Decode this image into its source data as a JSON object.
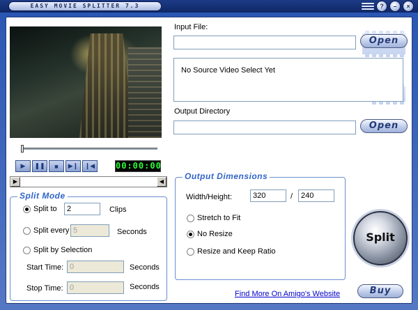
{
  "window": {
    "title": "EASY MOVIE SPLITTER 7.3",
    "minimize": "–",
    "close": "×",
    "help": "?"
  },
  "player": {
    "timecode": "00:00:00",
    "buttons": [
      "play",
      "pause",
      "stop",
      "next-frame",
      "previous"
    ]
  },
  "input": {
    "label": "Input File:",
    "value": "",
    "open_label": "Open",
    "info_text": "No Source Video Select Yet"
  },
  "output": {
    "label": "Output Directory",
    "value": "",
    "open_label": "Open"
  },
  "split_mode": {
    "title": "Split Mode",
    "split_to_label": "Split to",
    "split_to_value": "2",
    "clips_label": "Clips",
    "split_every_label": "Split every",
    "split_every_value": "5",
    "seconds_label": "Seconds",
    "split_by_selection_label": "Split by Selection",
    "start_time_label": "Start Time:",
    "start_time_value": "0",
    "stop_time_label": "Stop Time:",
    "stop_time_value": "0",
    "selected": "split_to"
  },
  "output_dimensions": {
    "title": "Output Dimensions",
    "wh_label": "Width/Height:",
    "width": "320",
    "separator": "/",
    "height": "240",
    "stretch_label": "Stretch to Fit",
    "no_resize_label": "No Resize",
    "keep_ratio_label": "Resize and Keep Ratio",
    "selected": "no_resize"
  },
  "actions": {
    "split_label": "Split",
    "buy_label": "Buy",
    "website_link": "Find More On Amigo's Website"
  }
}
